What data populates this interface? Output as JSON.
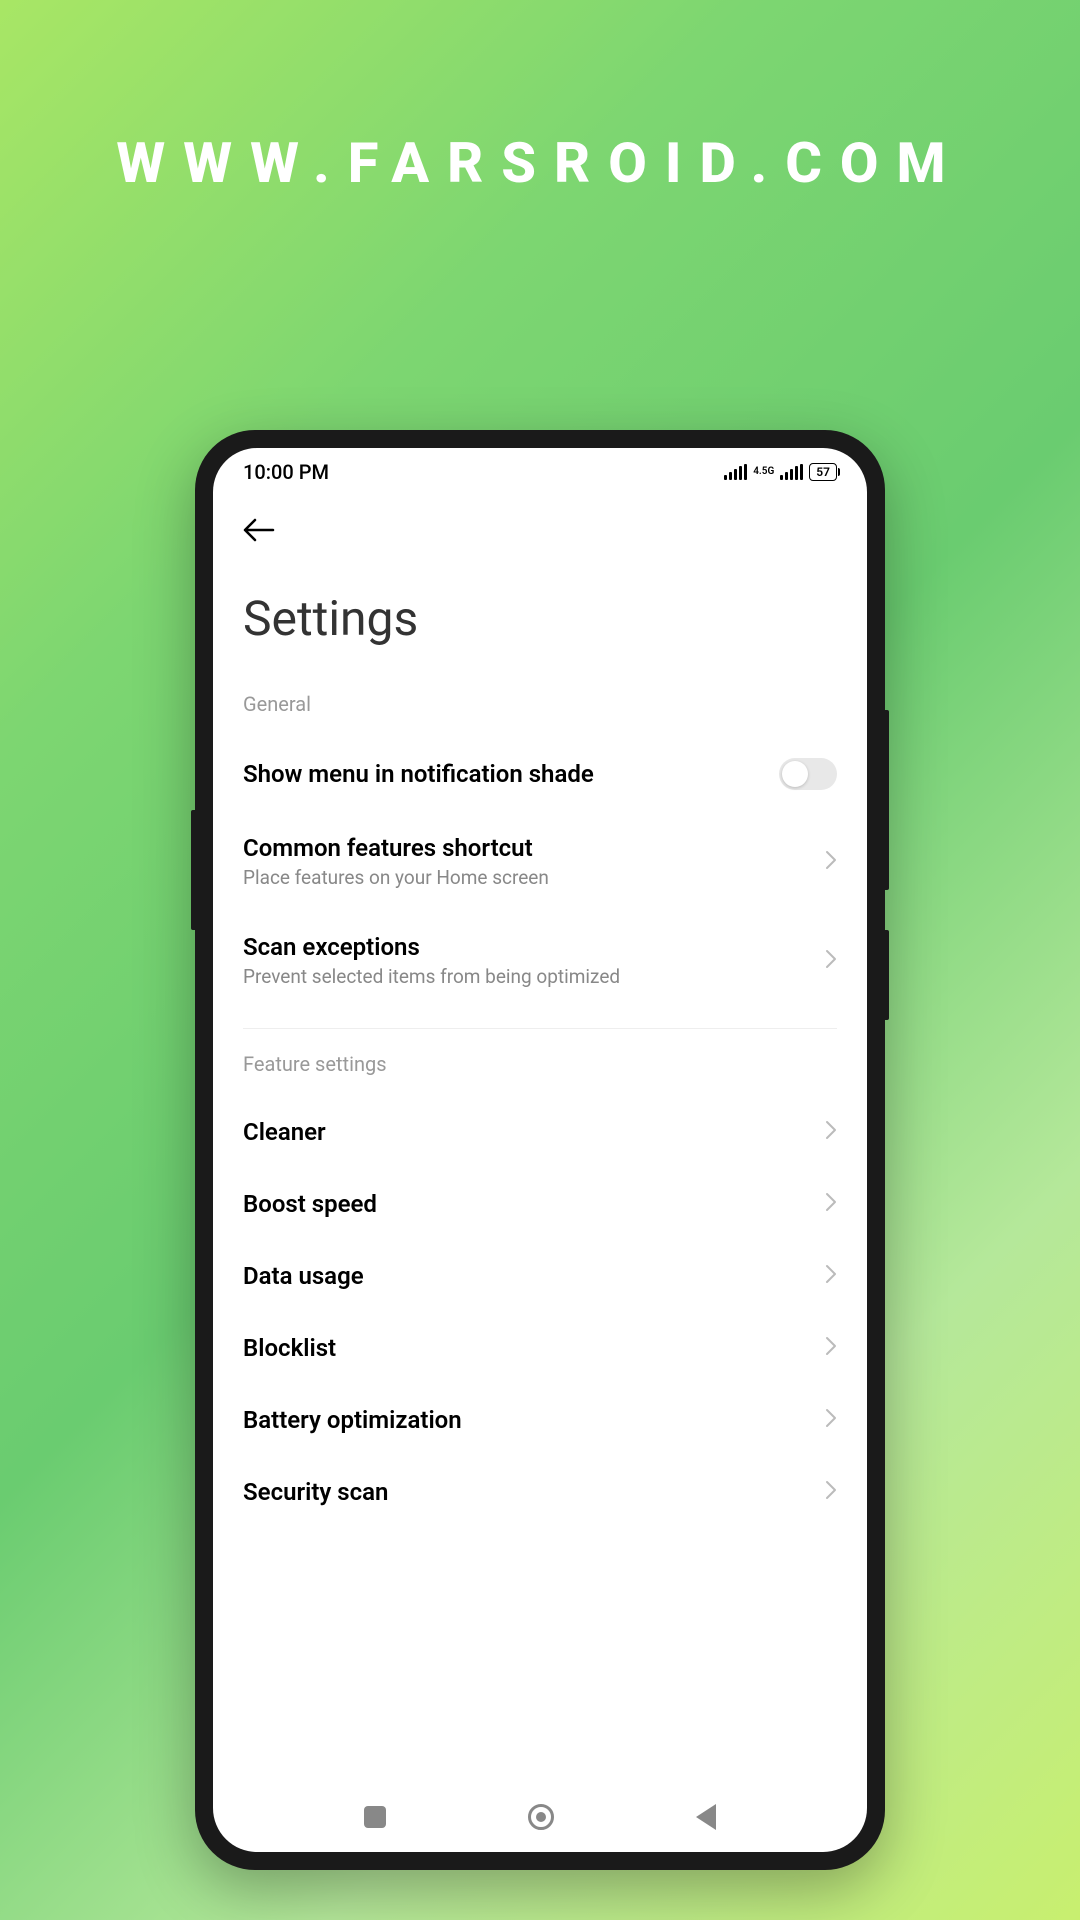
{
  "watermark": "WWW.FARSROID.COM",
  "statusBar": {
    "time": "10:00 PM",
    "networkLabel": "4.5G",
    "batteryLevel": "57"
  },
  "pageTitle": "Settings",
  "sections": {
    "general": {
      "label": "General",
      "items": [
        {
          "title": "Show menu in notification shade",
          "type": "toggle"
        },
        {
          "title": "Common features shortcut",
          "subtitle": "Place features on your Home screen",
          "type": "link"
        },
        {
          "title": "Scan exceptions",
          "subtitle": "Prevent selected items from being optimized",
          "type": "link"
        }
      ]
    },
    "features": {
      "label": "Feature settings",
      "items": [
        {
          "title": "Cleaner"
        },
        {
          "title": "Boost speed"
        },
        {
          "title": "Data usage"
        },
        {
          "title": "Blocklist"
        },
        {
          "title": "Battery optimization"
        },
        {
          "title": "Security scan"
        }
      ]
    }
  }
}
